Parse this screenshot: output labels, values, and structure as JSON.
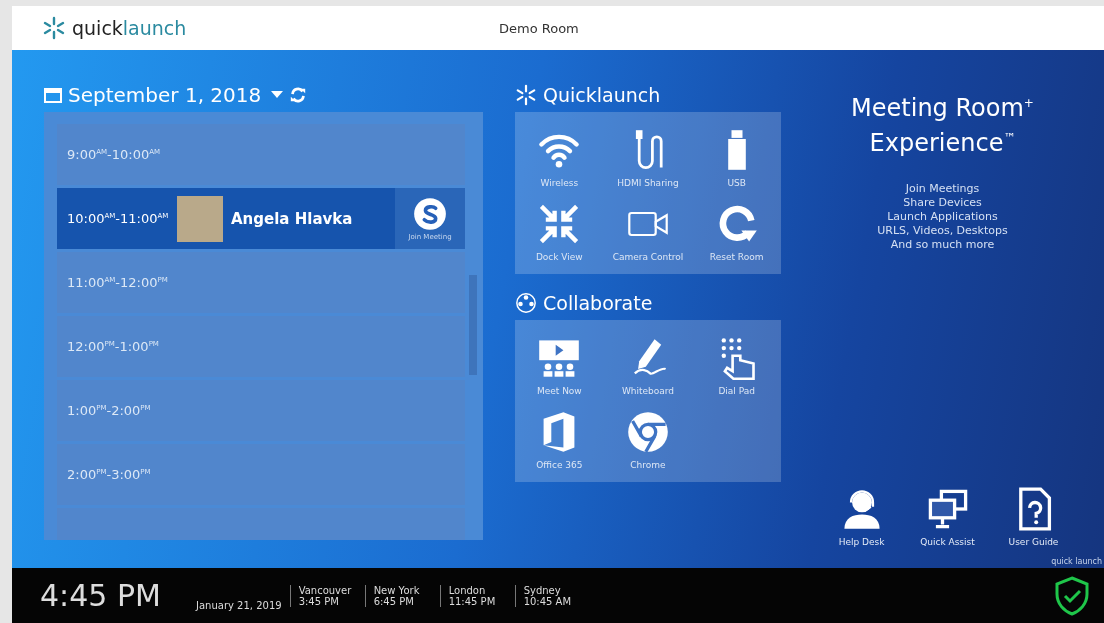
{
  "header": {
    "logo": [
      "quick",
      "launch"
    ],
    "room": "Demo Room"
  },
  "calendar": {
    "date": "September 1, 2018",
    "slots": [
      {
        "time": "9:00$^{AM}$-10:00$^{AM}$",
        "selected": false
      },
      {
        "time": "10:00$^{AM}$-11:00$^{AM}$",
        "selected": true,
        "organizer": "Angela Hlavka",
        "action": "Join Meeting"
      },
      {
        "time": "11:00$^{AM}$-12:00$^{PM}$",
        "selected": false
      },
      {
        "time": "12:00$^{PM}$-1:00$^{PM}$",
        "selected": false
      },
      {
        "time": "1:00$^{PM}$-2:00$^{PM}$",
        "selected": false
      },
      {
        "time": "2:00$^{PM}$-3:00$^{PM}$",
        "selected": false
      },
      {
        "selected": false
      }
    ]
  },
  "quicklaunch": {
    "title": "Quicklaunch",
    "tiles": [
      {
        "label": "Wireless",
        "kind": "wifi"
      },
      {
        "label": "HDMI Sharing",
        "kind": "cable"
      },
      {
        "label": "USB",
        "kind": "usb"
      },
      {
        "label": "Dock View",
        "kind": "dock"
      },
      {
        "label": "Camera Control",
        "kind": "camera"
      },
      {
        "label": "Reset Room",
        "kind": "reset"
      }
    ]
  },
  "collaborate": {
    "title": "Collaborate",
    "tiles": [
      {
        "label": "Meet Now",
        "kind": "meet"
      },
      {
        "label": "Whiteboard",
        "kind": "pen"
      },
      {
        "label": "Dial Pad",
        "kind": "dialpad"
      },
      {
        "label": "Office 365",
        "kind": "office"
      },
      {
        "label": "Chrome",
        "kind": "chrome"
      }
    ]
  },
  "promo": {
    "title": [
      "Meeting Room$^{+}$",
      "Experience$^{™}$"
    ],
    "features": [
      "Join Meetings",
      "Share Devices",
      "Launch Applications",
      "URLS, Videos, Desktops",
      "And so much more"
    ]
  },
  "support": [
    {
      "label": "Help Desk",
      "kind": "headset"
    },
    {
      "label": "Quick Assist",
      "kind": "monitors"
    },
    {
      "label": "User Guide",
      "kind": "guide"
    }
  ],
  "corner_logo": "quick launch",
  "footer": {
    "time": "4:45 PM",
    "date": "January 21, 2019",
    "clocks": [
      {
        "city": "Vancouver",
        "time": "3:45 PM"
      },
      {
        "city": "New York",
        "time": "6:45 PM"
      },
      {
        "city": "London",
        "time": "11:45 PM"
      },
      {
        "city": "Sydney",
        "time": "10:45 AM"
      }
    ]
  }
}
